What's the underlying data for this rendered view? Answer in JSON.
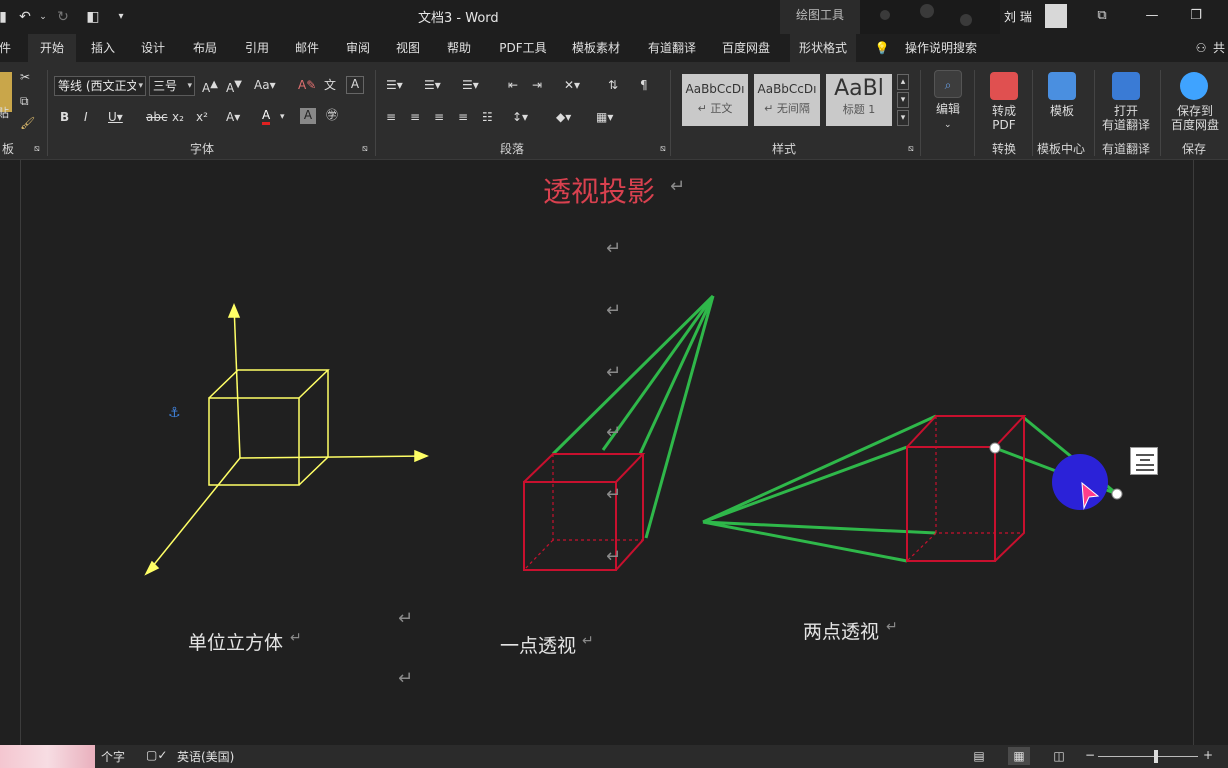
{
  "titlebar": {
    "title": "文档3  -  Word",
    "context_tool": "绘图工具",
    "user": "刘 瑞"
  },
  "tabs": [
    {
      "label": "件"
    },
    {
      "label": "开始",
      "active": true
    },
    {
      "label": "插入"
    },
    {
      "label": "设计"
    },
    {
      "label": "布局"
    },
    {
      "label": "引用"
    },
    {
      "label": "邮件"
    },
    {
      "label": "审阅"
    },
    {
      "label": "视图"
    },
    {
      "label": "帮助"
    },
    {
      "label": "PDF工具"
    },
    {
      "label": "模板素材"
    },
    {
      "label": "有道翻译"
    },
    {
      "label": "百度网盘"
    },
    {
      "label": "形状格式"
    }
  ],
  "tell_me": "操作说明搜索",
  "share": "共",
  "ribbon": {
    "clipboard": {
      "paste": "贴",
      "label": "板"
    },
    "font": {
      "font_name": "等线 (西文正文)",
      "font_size": "三号",
      "label": "字体"
    },
    "paragraph": {
      "label": "段落"
    },
    "styles": {
      "label": "样式",
      "items": [
        {
          "sample": "AaBbCcDı",
          "name": "↵ 正文"
        },
        {
          "sample": "AaBbCcDı",
          "name": "↵ 无间隔"
        },
        {
          "sample": "AaBl",
          "name": "标题 1"
        }
      ]
    },
    "edit": {
      "label": "编辑"
    },
    "convert": {
      "button": "转成\nPDF",
      "label": "转换"
    },
    "template": {
      "button": "模板",
      "label": "模板中心"
    },
    "youdao": {
      "button": "打开\n有道翻译",
      "label": "有道翻译"
    },
    "baidu": {
      "button": "保存到\n百度网盘",
      "label": "保存"
    }
  },
  "document": {
    "heading": "透视投影",
    "captions": [
      "单位立方体",
      "一点透视",
      "两点透视"
    ]
  },
  "status": {
    "word_count": "个字",
    "language": "英语(美国)"
  },
  "zoom": {
    "value_fraction": 0.58
  },
  "colors": {
    "heading": "#d9414f",
    "cube_yellow": "#ffff66",
    "cube_red": "#c8102e",
    "lines_green": "#2fb84a",
    "cursor_blue": "#2b22d8"
  }
}
